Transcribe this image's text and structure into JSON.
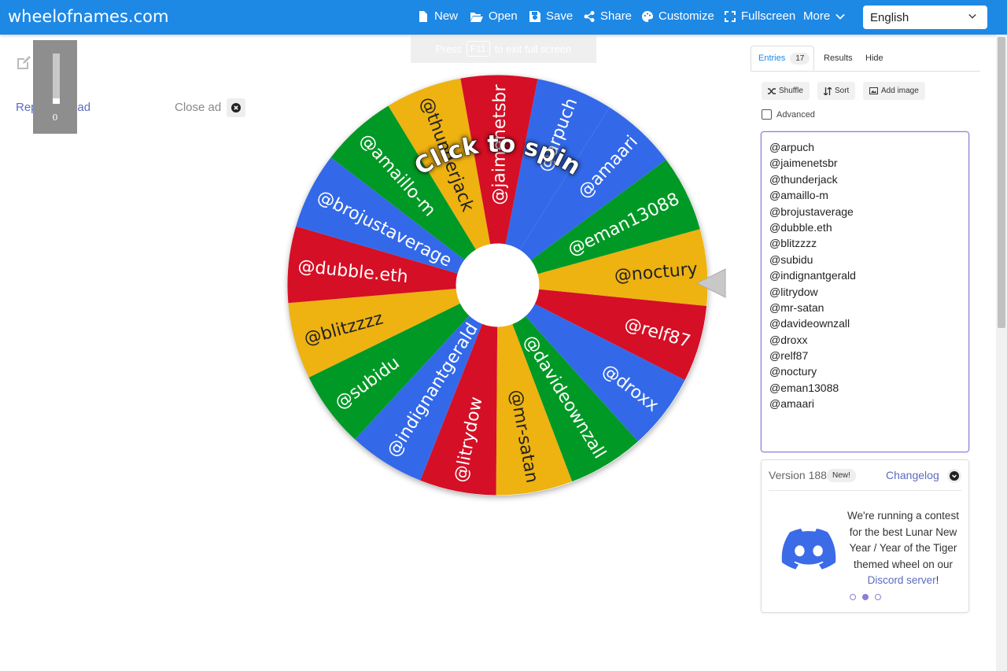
{
  "brand": "wheelofnames.com",
  "nav": {
    "new": "New",
    "open": "Open",
    "save": "Save",
    "share": "Share",
    "customize": "Customize",
    "fullscreen": "Fullscreen",
    "more": "More",
    "language": "English"
  },
  "fullscreen_hint": {
    "prefix": "Press",
    "key": "F11",
    "suffix": "to exit full screen"
  },
  "ad": {
    "counter": "0",
    "report": "Report bad ad",
    "close": "Close ad"
  },
  "wheel": {
    "spin_label": "Click to spin",
    "slices": [
      {
        "name": "@arpuch",
        "color": "#3369e8"
      },
      {
        "name": "@amaari",
        "color": "#3369e8"
      },
      {
        "name": "@eman13088",
        "color": "#009925"
      },
      {
        "name": "@noctury",
        "color": "#eeb211"
      },
      {
        "name": "@relf87",
        "color": "#d50f25"
      },
      {
        "name": "@droxx",
        "color": "#3369e8"
      },
      {
        "name": "@davideownzall",
        "color": "#009925"
      },
      {
        "name": "@mr-satan",
        "color": "#eeb211"
      },
      {
        "name": "@litrydow",
        "color": "#d50f25"
      },
      {
        "name": "@indignantgerald",
        "color": "#3369e8"
      },
      {
        "name": "@subidu",
        "color": "#009925"
      },
      {
        "name": "@blitzzzz",
        "color": "#eeb211"
      },
      {
        "name": "@dubble.eth",
        "color": "#d50f25"
      },
      {
        "name": "@brojustaverage",
        "color": "#3369e8"
      },
      {
        "name": "@amaillo-m",
        "color": "#009925"
      },
      {
        "name": "@thunderjack",
        "color": "#eeb211"
      },
      {
        "name": "@jaimenetsbr",
        "color": "#d50f25"
      }
    ]
  },
  "panel": {
    "tabs": {
      "entries": "Entries",
      "entries_count": "17",
      "results": "Results",
      "hide": "Hide"
    },
    "tools": {
      "shuffle": "Shuffle",
      "sort": "Sort",
      "add_image": "Add image"
    },
    "advanced": "Advanced",
    "entries": [
      "@arpuch",
      "@jaimenetsbr",
      "@thunderjack",
      "@amaillo-m",
      "@brojustaverage",
      "@dubble.eth",
      "@blitzzzz",
      "@subidu",
      "@indignantgerald",
      "@litrydow",
      "@mr-satan",
      "@davideownzall",
      "@droxx",
      "@relf87",
      "@noctury",
      "@eman13088",
      "@amaari"
    ]
  },
  "changelog": {
    "version": "Version 188",
    "new_badge": "New!",
    "link": "Changelog",
    "message": "We're running a contest for the best Lunar New Year / Year of the Tiger themed wheel on our",
    "discord_link": "Discord server",
    "suffix": "!"
  },
  "colors": {
    "navbar": "#1e88e5",
    "accent": "#5c6bc0",
    "blue": "#3369e8",
    "green": "#009925",
    "yellow": "#eeb211",
    "red": "#d50f25"
  }
}
